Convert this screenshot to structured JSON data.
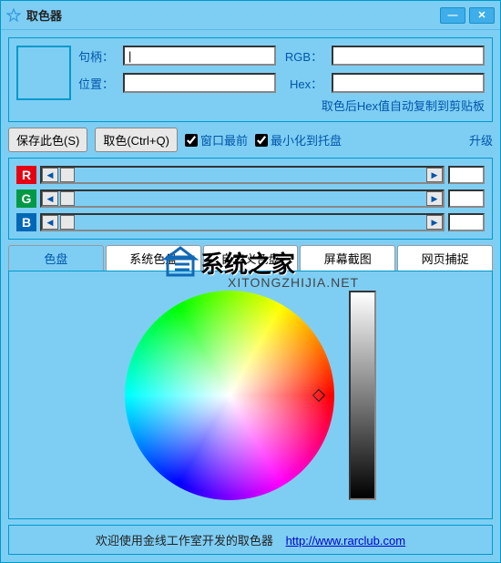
{
  "titlebar": {
    "title": "取色器"
  },
  "fields": {
    "handle_label": "句柄：",
    "handle_value": "|",
    "rgb_label": "RGB：",
    "rgb_value": "",
    "pos_label": "位置：",
    "pos_value": "",
    "hex_label": "Hex：",
    "hex_value": ""
  },
  "hint": "取色后Hex值自动复制到剪贴板",
  "buttons": {
    "save": "保存此色(S)",
    "pick": "取色(Ctrl+Q)"
  },
  "checks": {
    "topmost": "窗口最前",
    "tray": "最小化到托盘"
  },
  "upgrade": "升级",
  "sliders": {
    "r_label": "R",
    "r_value": "",
    "g_label": "G",
    "g_value": "",
    "b_label": "B",
    "b_value": ""
  },
  "tabs": [
    "色盘",
    "系统色盘",
    "自定义色盘",
    "屏幕截图",
    "网页捕捉"
  ],
  "footer": {
    "text": "欢迎使用金线工作室开发的取色器",
    "url": "http://www.rarclub.com"
  },
  "watermark": {
    "main": "系统之家",
    "sub": "XITONGZHIJIA.NET"
  }
}
